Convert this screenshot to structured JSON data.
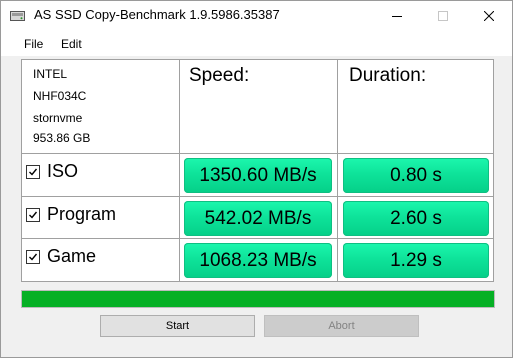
{
  "window": {
    "title": "AS SSD Copy-Benchmark 1.9.5986.35387",
    "icon": "drive-icon"
  },
  "menu": {
    "file": "File",
    "edit": "Edit"
  },
  "drive": {
    "vendor": "INTEL",
    "model": "NHF034C",
    "driver": "stornvme",
    "capacity": "953.86 GB"
  },
  "columns": {
    "speed": "Speed:",
    "duration": "Duration:"
  },
  "rows": [
    {
      "label": "ISO",
      "checked": true,
      "speed": "1350.60 MB/s",
      "duration": "0.80 s"
    },
    {
      "label": "Program",
      "checked": true,
      "speed": "542.02 MB/s",
      "duration": "2.60 s"
    },
    {
      "label": "Game",
      "checked": true,
      "speed": "1068.23 MB/s",
      "duration": "1.29 s"
    }
  ],
  "progress": {
    "fraction": 1.0,
    "color": "#06b025"
  },
  "buttons": {
    "start": "Start",
    "abort": "Abort"
  },
  "colors": {
    "result_green": "#0ee39a"
  }
}
